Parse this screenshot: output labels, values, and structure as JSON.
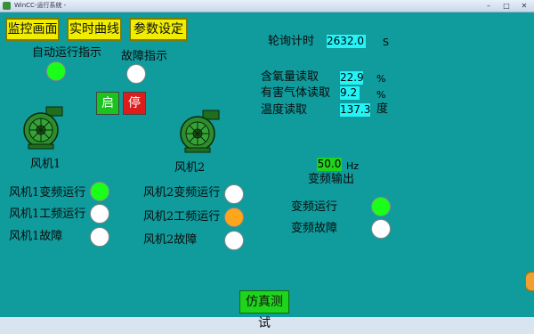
{
  "window": {
    "title": "WinCC-运行系统 -"
  },
  "nav": {
    "monitor": "监控画面",
    "trend": "实时曲线",
    "params": "参数设定"
  },
  "auto_run": {
    "label": "自动运行指示",
    "state": "green"
  },
  "fault": {
    "label": "故障指示",
    "state": "white"
  },
  "controls": {
    "start": "启",
    "stop": "停"
  },
  "fan1": {
    "label": "风机1"
  },
  "fan2": {
    "label": "风机2"
  },
  "fan1_status": [
    {
      "label": "风机1变频运行",
      "state": "green"
    },
    {
      "label": "风机1工频运行",
      "state": "white"
    },
    {
      "label": "风机1故障",
      "state": "white"
    }
  ],
  "fan2_status": [
    {
      "label": "风机2变频运行",
      "state": "white"
    },
    {
      "label": "风机2工频运行",
      "state": "orange"
    },
    {
      "label": "风机2故障",
      "state": "white"
    }
  ],
  "timer": {
    "label": "轮询计时",
    "value": "2632.0",
    "unit": "S"
  },
  "readings": [
    {
      "label": "含氧量读取",
      "value": "22.9",
      "unit": "%"
    },
    {
      "label": "有害气体读取",
      "value": "9.2",
      "unit": "%"
    },
    {
      "label": "温度读取",
      "value": "137.3",
      "unit": "度"
    }
  ],
  "vfd": {
    "value": "50.0",
    "unit": "Hz",
    "label": "变频输出"
  },
  "vfd_status": [
    {
      "label": "变频运行",
      "state": "green"
    },
    {
      "label": "变频故障",
      "state": "white"
    }
  ],
  "sim": {
    "label": "仿真测试"
  },
  "colors": {
    "background": "#109b9c",
    "nav_button": "#f0ed00",
    "value_box": "#24f3f7",
    "lamp_on": "#1aff1a",
    "lamp_warn": "#ffa51c"
  }
}
